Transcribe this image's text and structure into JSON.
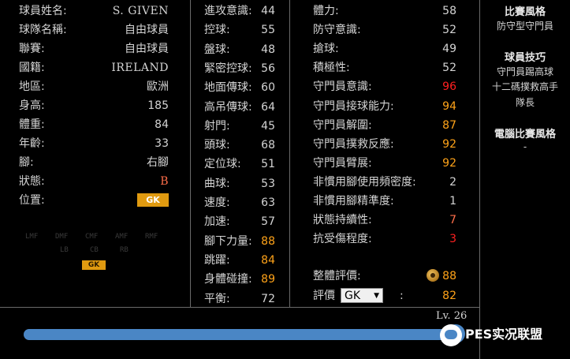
{
  "panel1": [
    {
      "label": "球員姓名:",
      "value": "S. GIVEN",
      "serif": true,
      "color": "white"
    },
    {
      "label": "球隊名稱:",
      "value": "自由球員",
      "color": "white"
    },
    {
      "label": "聯賽:",
      "value": "自由球員",
      "color": "white"
    },
    {
      "label": "國籍:",
      "value": "IRELAND",
      "serif": true,
      "color": "white"
    },
    {
      "label": "地區:",
      "value": "歐洲",
      "color": "white"
    },
    {
      "label": "身高:",
      "value": "185",
      "color": "white"
    },
    {
      "label": "體重:",
      "value": "84",
      "color": "white"
    },
    {
      "label": "年齡:",
      "value": "33",
      "color": "white"
    },
    {
      "label": "腳:",
      "value": "右腳",
      "color": "white"
    },
    {
      "label": "狀態:",
      "value": "B",
      "serif": true,
      "color": "coral"
    }
  ],
  "position": {
    "label": "位置:",
    "badge": "GK"
  },
  "position_grid": {
    "row1": [
      "LMF",
      "DMF",
      "CMF",
      "AMF",
      "RMF"
    ],
    "row2": [
      "",
      "LB",
      "CB",
      "RB",
      ""
    ],
    "gk": "GK"
  },
  "panel2": [
    {
      "label": "進攻意識:",
      "value": "44",
      "color": "white"
    },
    {
      "label": "控球:",
      "value": "55",
      "color": "white"
    },
    {
      "label": "盤球:",
      "value": "48",
      "color": "white"
    },
    {
      "label": "緊密控球:",
      "value": "56",
      "color": "white"
    },
    {
      "label": "地面傳球:",
      "value": "60",
      "color": "white"
    },
    {
      "label": "高吊傳球:",
      "value": "64",
      "color": "white"
    },
    {
      "label": "射門:",
      "value": "45",
      "color": "white"
    },
    {
      "label": "頭球:",
      "value": "68",
      "color": "white"
    },
    {
      "label": "定位球:",
      "value": "51",
      "color": "white"
    },
    {
      "label": "曲球:",
      "value": "53",
      "color": "white"
    },
    {
      "label": "速度:",
      "value": "63",
      "color": "white"
    },
    {
      "label": "加速:",
      "value": "57",
      "color": "white"
    },
    {
      "label": "腳下力量:",
      "value": "88",
      "color": "orange"
    },
    {
      "label": "跳躍:",
      "value": "84",
      "color": "orange"
    },
    {
      "label": "身體碰撞:",
      "value": "89",
      "color": "orange"
    },
    {
      "label": "平衡:",
      "value": "72",
      "color": "white"
    }
  ],
  "panel3": [
    {
      "label": "體力:",
      "value": "58",
      "color": "white"
    },
    {
      "label": "防守意識:",
      "value": "52",
      "color": "white"
    },
    {
      "label": "搶球:",
      "value": "49",
      "color": "white"
    },
    {
      "label": "積極性:",
      "value": "52",
      "color": "white"
    },
    {
      "label": "守門員意識:",
      "value": "96",
      "color": "red"
    },
    {
      "label": "守門員接球能力:",
      "value": "94",
      "color": "orange"
    },
    {
      "label": "守門員解圍:",
      "value": "87",
      "color": "orange"
    },
    {
      "label": "守門員撲救反應:",
      "value": "92",
      "color": "orange"
    },
    {
      "label": "守門員臂展:",
      "value": "92",
      "color": "orange"
    },
    {
      "label": "非慣用腳使用頻密度:",
      "value": "2",
      "color": "white"
    },
    {
      "label": "非慣用腳精準度:",
      "value": "1",
      "color": "white"
    },
    {
      "label": "狀態持續性:",
      "value": "7",
      "color": "coral"
    },
    {
      "label": "抗受傷程度:",
      "value": "3",
      "color": "red"
    }
  ],
  "overall": {
    "label": "整體評價:",
    "value": "88",
    "icon": "coin-icon"
  },
  "rating": {
    "label": "評價",
    "selected": "GK",
    "suffix": ":",
    "value": "82"
  },
  "sidebar": {
    "style_title": "比賽風格",
    "style_value": "防守型守門員",
    "skills_title": "球員技巧",
    "skills": [
      "守門員踢高球",
      "十二碼撲救高手",
      "隊長"
    ],
    "ai_title": "電腦比賽風格",
    "ai_value": "-"
  },
  "level": {
    "label": "Lv. 26",
    "progress": 1.0
  },
  "watermark": {
    "text": "PES实况联盟"
  },
  "colors": {
    "white": "#d4d4d4",
    "orange": "#ffa319",
    "red": "#ff2020",
    "coral": "#ff6e4a",
    "badge": "#e09a10",
    "bar": "#4a86c5"
  }
}
